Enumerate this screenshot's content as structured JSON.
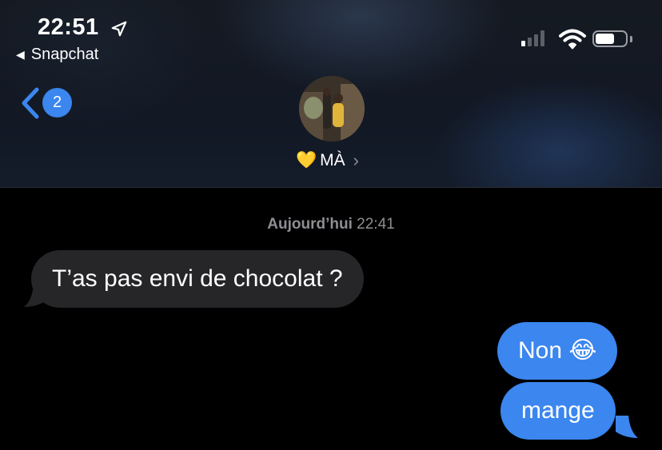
{
  "status_bar": {
    "time": "22:51",
    "back_app": "Snapchat"
  },
  "nav": {
    "unread_count": "2",
    "contact_name": "MÀ",
    "contact_emoji": "💛"
  },
  "conversation": {
    "date_label": "Aujourd’hui",
    "date_time": "22:41",
    "messages": [
      {
        "direction": "incoming",
        "text": "T’as pas envi de chocolat ?"
      },
      {
        "direction": "outgoing",
        "text": "Non 😂"
      },
      {
        "direction": "outgoing",
        "text": "mange"
      }
    ]
  },
  "colors": {
    "outgoing_bubble": "#3b86ef",
    "incoming_bubble": "#262628",
    "accent": "#3b86ef"
  }
}
